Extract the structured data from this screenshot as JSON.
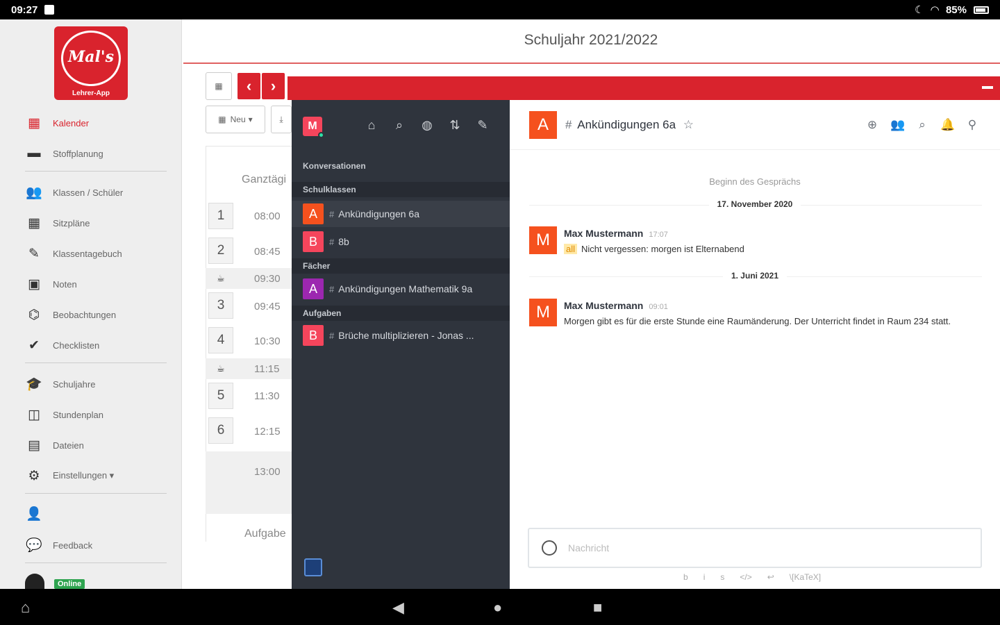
{
  "statusbar": {
    "time": "09:27",
    "battery": "85%"
  },
  "sidebar": {
    "logo_text": "Mal's",
    "logo_caption": "Lehrer-App",
    "items": [
      {
        "label": "Kalender",
        "icon": "calendar-icon",
        "glyph": "▦",
        "active": true
      },
      {
        "label": "Stoffplanung",
        "icon": "planner-icon",
        "glyph": "▬"
      },
      {
        "label": "Klassen / Schüler",
        "icon": "students-icon",
        "glyph": "👥"
      },
      {
        "label": "Sitzpläne",
        "icon": "grid-icon",
        "glyph": "▦"
      },
      {
        "label": "Klassentagebuch",
        "icon": "book-icon",
        "glyph": "✎"
      },
      {
        "label": "Noten",
        "icon": "grades-icon",
        "glyph": "▣"
      },
      {
        "label": "Beobachtungen",
        "icon": "binoculars-icon",
        "glyph": "⌬"
      },
      {
        "label": "Checklisten",
        "icon": "check-circle-icon",
        "glyph": "✔"
      },
      {
        "label": "Schuljahre",
        "icon": "graduation-cap-icon",
        "glyph": "🎓"
      },
      {
        "label": "Stundenplan",
        "icon": "timetable-icon",
        "glyph": "◫"
      },
      {
        "label": "Dateien",
        "icon": "file-icon",
        "glyph": "▤"
      },
      {
        "label": "Einstellungen ▾",
        "icon": "gear-icon",
        "glyph": "⚙"
      },
      {
        "label": "",
        "icon": "user-icon",
        "glyph": "👤"
      },
      {
        "label": "Feedback",
        "icon": "speech-bubble-icon",
        "glyph": "💬"
      }
    ],
    "online_badge": "Online"
  },
  "main": {
    "title": "Schuljahr 2021/2022",
    "new_button": "Neu",
    "ganztag_label": "Ganztägi",
    "aufgaben_label": "Aufgabe",
    "rows": [
      {
        "num": "1",
        "time": "08:00"
      },
      {
        "num": "2",
        "time": "08:45"
      },
      {
        "num": "",
        "time": "09:30",
        "break": true
      },
      {
        "num": "3",
        "time": "09:45"
      },
      {
        "num": "4",
        "time": "10:30"
      },
      {
        "num": "",
        "time": "11:15",
        "break": true
      },
      {
        "num": "5",
        "time": "11:30"
      },
      {
        "num": "6",
        "time": "12:15"
      },
      {
        "num": "",
        "time": "13:00"
      }
    ]
  },
  "chat": {
    "user_initial": "M",
    "sections": {
      "conversations": "Konversationen",
      "schulklassen": "Schulklassen",
      "faecher": "Fächer",
      "aufgaben": "Aufgaben"
    },
    "rooms": [
      {
        "initial": "A",
        "name": "Ankündigungen 6a",
        "color": "#f5511e",
        "selected": true
      },
      {
        "initial": "B",
        "name": "8b",
        "color": "#f5455c"
      },
      {
        "initial": "A",
        "name": "Ankündigungen Mathematik 9a",
        "color": "#9c27b0"
      },
      {
        "initial": "B",
        "name": "Brüche multiplizieren - Jonas ...",
        "color": "#f5455c"
      }
    ],
    "header": {
      "initial": "A",
      "title": "Ankündigungen 6a"
    },
    "start_label": "Beginn des Gesprächs",
    "days": [
      {
        "date": "17. November 2020",
        "message": {
          "initial": "M",
          "user": "Max Mustermann",
          "time": "17:07",
          "mention": "all",
          "text": "Nicht vergessen: morgen ist Elternabend"
        }
      },
      {
        "date": "1. Juni 2021",
        "message": {
          "initial": "M",
          "user": "Max Mustermann",
          "time": "09:01",
          "mention": "",
          "text": "Morgen gibt es für die erste Stunde eine Raumänderung. Der Unterricht findet in Raum 234 statt."
        }
      }
    ],
    "composer_placeholder": "Nachricht",
    "format_tools": [
      "b",
      "i",
      "s",
      "</>",
      "↩",
      "\\[KaTeX]"
    ]
  }
}
